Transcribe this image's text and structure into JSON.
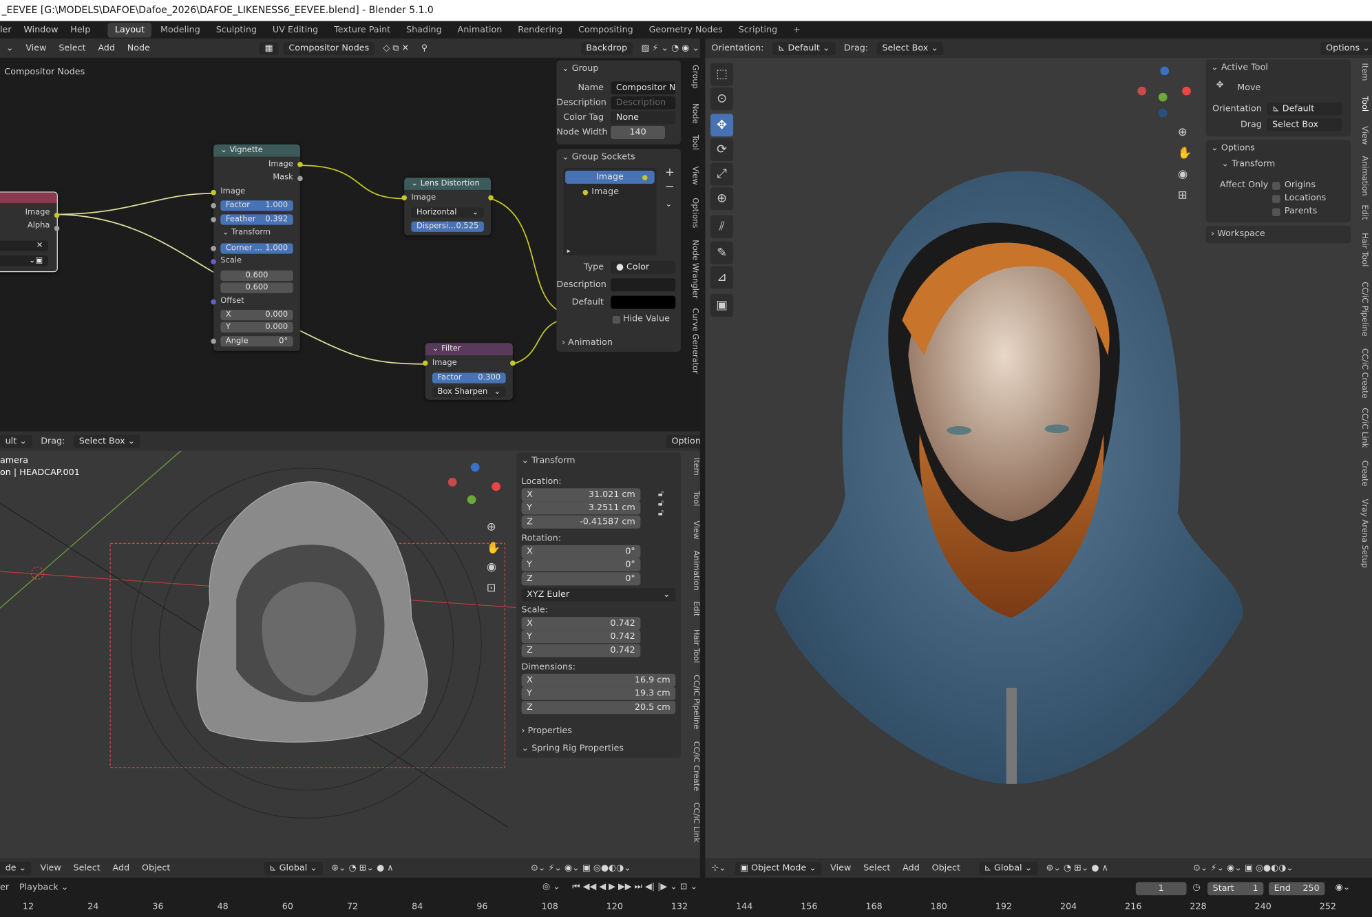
{
  "title": "_EEVEE [G:\\MODELS\\DAFOE\\Dafoe_2026\\DAFOE_LIKENESS6_EEVEE.blend] - Blender 5.1.0",
  "menu": [
    "ler",
    "Window",
    "Help"
  ],
  "workspaces": [
    {
      "label": "Layout",
      "active": true
    },
    {
      "label": "Modeling"
    },
    {
      "label": "Sculpting"
    },
    {
      "label": "UV Editing"
    },
    {
      "label": "Texture Paint"
    },
    {
      "label": "Shading"
    },
    {
      "label": "Animation"
    },
    {
      "label": "Rendering"
    },
    {
      "label": "Compositing"
    },
    {
      "label": "Geometry Nodes"
    },
    {
      "label": "Scripting"
    },
    {
      "label": "+"
    }
  ],
  "node_editor": {
    "menus": [
      "View",
      "Select",
      "Add",
      "Node"
    ],
    "tree_name": "Compositor Nodes",
    "backdrop": "Backdrop",
    "breadcrumb": "Compositor Nodes"
  },
  "nodes": {
    "partial": {
      "image": "Image",
      "alpha": "Alpha"
    },
    "vignette": {
      "title": "Vignette",
      "out_image": "Image",
      "out_mask": "Mask",
      "in_image": "Image",
      "factor_label": "Factor",
      "factor": "1.000",
      "feather_label": "Feather",
      "feather": "0.392",
      "transform": "Transform",
      "corner_label": "Corner ...",
      "corner": "1.000",
      "scale": "Scale",
      "scale_x": "0.600",
      "scale_y": "0.600",
      "offset": "Offset",
      "x_label": "X",
      "x": "0.000",
      "y_label": "Y",
      "y": "0.000",
      "angle_label": "Angle",
      "angle": "0°"
    },
    "lens": {
      "title": "Lens Distortion",
      "image": "Image",
      "mode": "Horizontal",
      "disp_label": "Dispersi...",
      "disp": "0.525"
    },
    "filter": {
      "title": "Filter",
      "image": "Image",
      "factor_label": "Factor",
      "factor": "0.300",
      "type": "Box Sharpen"
    }
  },
  "group_panel": {
    "group": "Group",
    "name_label": "Name",
    "name": "Compositor N...",
    "desc_label": "Description",
    "desc_placeholder": "Description",
    "colortag_label": "Color Tag",
    "colortag": "None",
    "width_label": "Node Width",
    "width": "140",
    "sockets": "Group Sockets",
    "socket_out": "Image",
    "socket_in": "Image",
    "type_label": "Type",
    "type": "Color",
    "desc2_label": "Description",
    "default_label": "Default",
    "hide_value": "Hide Value",
    "animation": "Animation"
  },
  "ne_tabs": [
    "Group",
    "Node",
    "Tool",
    "View",
    "Options",
    "Node Wrangler",
    "Curve Generator"
  ],
  "vp_left": {
    "header": [
      "ult",
      "Drag:",
      "Select Box",
      "Options"
    ],
    "cam": "amera",
    "obj": "on | HEADCAP.001",
    "footer": [
      "de",
      "View",
      "Select",
      "Add",
      "Object",
      "Global"
    ]
  },
  "transform": {
    "title": "Transform",
    "location": "Location:",
    "loc": [
      {
        "a": "X",
        "v": "31.021 cm"
      },
      {
        "a": "Y",
        "v": "3.2511 cm"
      },
      {
        "a": "Z",
        "v": "-0.41587 cm"
      }
    ],
    "rotation": "Rotation:",
    "rot": [
      {
        "a": "X",
        "v": "0°"
      },
      {
        "a": "Y",
        "v": "0°"
      },
      {
        "a": "Z",
        "v": "0°"
      }
    ],
    "euler": "XYZ Euler",
    "scale": "Scale:",
    "scl": [
      {
        "a": "X",
        "v": "0.742"
      },
      {
        "a": "Y",
        "v": "0.742"
      },
      {
        "a": "Z",
        "v": "0.742"
      }
    ],
    "dimensions": "Dimensions:",
    "dim": [
      {
        "a": "X",
        "v": "16.9 cm"
      },
      {
        "a": "Y",
        "v": "19.3 cm"
      },
      {
        "a": "Z",
        "v": "20.5 cm"
      }
    ],
    "properties": "Properties",
    "spring": "Spring Rig Properties"
  },
  "vp_left_tabs": [
    "Item",
    "Tool",
    "View",
    "Animation",
    "Edit",
    "Hair Tool",
    "CC/iC Pipeline",
    "CC/iC Create",
    "CC/iC Link"
  ],
  "vp_right": {
    "orientation_label": "Orientation:",
    "orientation": "Default",
    "drag_label": "Drag:",
    "drag": "Select Box",
    "options": "Options",
    "footer": [
      "Object Mode",
      "View",
      "Select",
      "Add",
      "Object",
      "Global"
    ]
  },
  "tool_panel": {
    "active_tool": "Active Tool",
    "move": "Move",
    "orient_label": "Orientation",
    "orient": "Default",
    "drag_label": "Drag",
    "drag": "Select Box",
    "options": "Options",
    "transform": "Transform",
    "affect": "Affect Only",
    "origins": "Origins",
    "locations": "Locations",
    "parents": "Parents",
    "workspace": "Workspace"
  },
  "vp_right_tabs": [
    "Item",
    "Tool",
    "View",
    "Animation",
    "Edit",
    "Hair Tool",
    "CC/iC Pipeline",
    "CC/iC Create",
    "CC/iC Link",
    "Create",
    "Vray Arena Setup"
  ],
  "timeline": {
    "playback": "Playback",
    "frame": "1",
    "start_label": "Start",
    "start": "1",
    "end_label": "End",
    "end": "250",
    "ticks": [
      "12",
      "24",
      "36",
      "48",
      "60",
      "72",
      "84",
      "96",
      "108",
      "120",
      "132",
      "144",
      "156",
      "168",
      "180",
      "192",
      "204",
      "216",
      "228",
      "240",
      "252"
    ]
  },
  "colors": {
    "accent": "#4772b3",
    "socket_yellow": "#c7c729",
    "bg": "#1d1d1d",
    "panel": "#303030"
  }
}
